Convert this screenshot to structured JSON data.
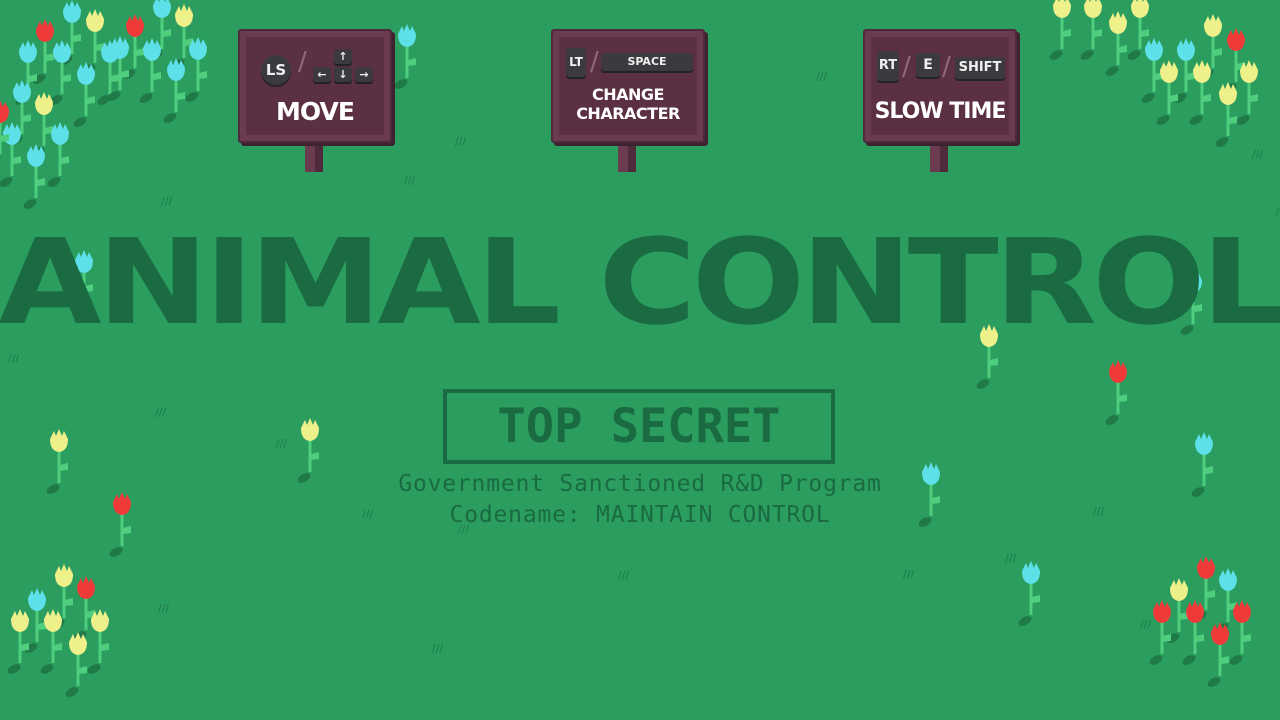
{
  "game": {
    "title": "ANIMAL CONTROL",
    "stamp": "TOP SECRET",
    "brief_line1": "Government Sanctioned R&D Program",
    "brief_line2": "Codename: MAINTAIN CONTROL"
  },
  "control_signs": [
    {
      "action": "MOVE",
      "gamepad_key": "LS",
      "keyboard_keys": [
        "↑",
        "←",
        "↓",
        "→"
      ]
    },
    {
      "action": "CHANGE CHARACTER",
      "action_line1": "CHANGE",
      "action_line2": "CHARACTER",
      "gamepad_key": "LT",
      "keyboard_key": "SPACE"
    },
    {
      "action": "SLOW TIME",
      "gamepad_key": "RT",
      "keyboard_key_1": "E",
      "keyboard_key_2": "SHIFT"
    }
  ],
  "colors": {
    "grass": "#2a9d5f",
    "title_ink": "#1a6a42",
    "sign_wood": "#6b3b50",
    "sign_panel": "#5a3042",
    "key_cap": "#3d3a3f",
    "flower_red": "#f03a3a",
    "flower_yellow": "#eef08a",
    "flower_cyan": "#5ee0e8",
    "stem": "#4fcf7e",
    "shadow": "#1f7a48"
  },
  "decor": {
    "flower_icon": "tulip-flower-icon",
    "grass_mark": "grass-tuft-icon"
  }
}
